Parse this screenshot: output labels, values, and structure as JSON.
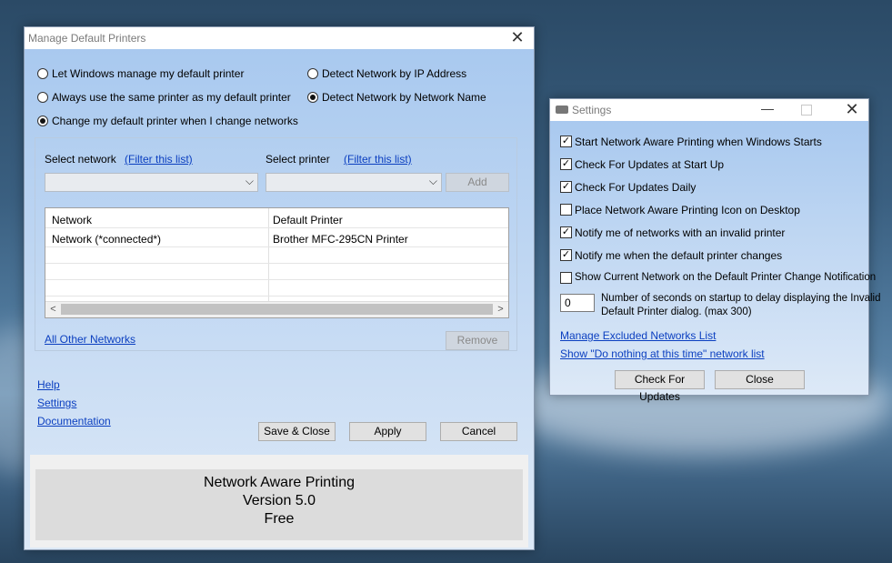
{
  "main_window": {
    "title": "Manage Default Printers",
    "radio_options": [
      {
        "label": "Let Windows manage my default printer",
        "selected": false
      },
      {
        "label": "Always use the same printer as my default printer",
        "selected": false
      },
      {
        "label": "Change my default printer when I change networks",
        "selected": true
      }
    ],
    "detect_options": [
      {
        "label": "Detect Network by IP Address",
        "selected": false
      },
      {
        "label": "Detect Network by Network Name",
        "selected": true
      }
    ],
    "select_network_label": "Select network",
    "select_printer_label": "Select printer",
    "filter_link": "(Filter this list)",
    "add_button": "Add",
    "grid": {
      "headers": [
        "Network",
        "Default Printer"
      ],
      "rows": [
        [
          "Network (*connected*)",
          "Brother MFC-295CN Printer"
        ]
      ]
    },
    "all_other_networks_link": "All Other Networks",
    "remove_button": "Remove",
    "links": [
      "Help",
      "Settings",
      "Documentation"
    ],
    "save_close_button": "Save & Close",
    "apply_button": "Apply",
    "cancel_button": "Cancel",
    "banner": {
      "line1": "Network Aware Printing",
      "line2": "Version 5.0",
      "line3": "Free"
    }
  },
  "settings_window": {
    "title": "Settings",
    "checkboxes": [
      {
        "label": "Start Network Aware Printing when Windows Starts",
        "checked": true
      },
      {
        "label": "Check For Updates at Start Up",
        "checked": true
      },
      {
        "label": "Check For Updates Daily",
        "checked": true
      },
      {
        "label": "Place Network Aware Printing Icon on Desktop",
        "checked": false
      },
      {
        "label": "Notify me of networks with an invalid printer",
        "checked": true
      },
      {
        "label": "Notify me when the default printer changes",
        "checked": true
      },
      {
        "label": "Show Current Network on the Default Printer Change Notification",
        "checked": false
      }
    ],
    "delay_value": "0",
    "delay_label_line1": "Number of seconds on startup to delay displaying the Invalid",
    "delay_label_line2": "Default Printer dialog. (max 300)",
    "manage_excluded_link": "Manage Excluded Networks List",
    "show_do_nothing_link": "Show \"Do nothing at this time\" network list",
    "check_updates_button": "Check For Updates",
    "close_button": "Close"
  }
}
